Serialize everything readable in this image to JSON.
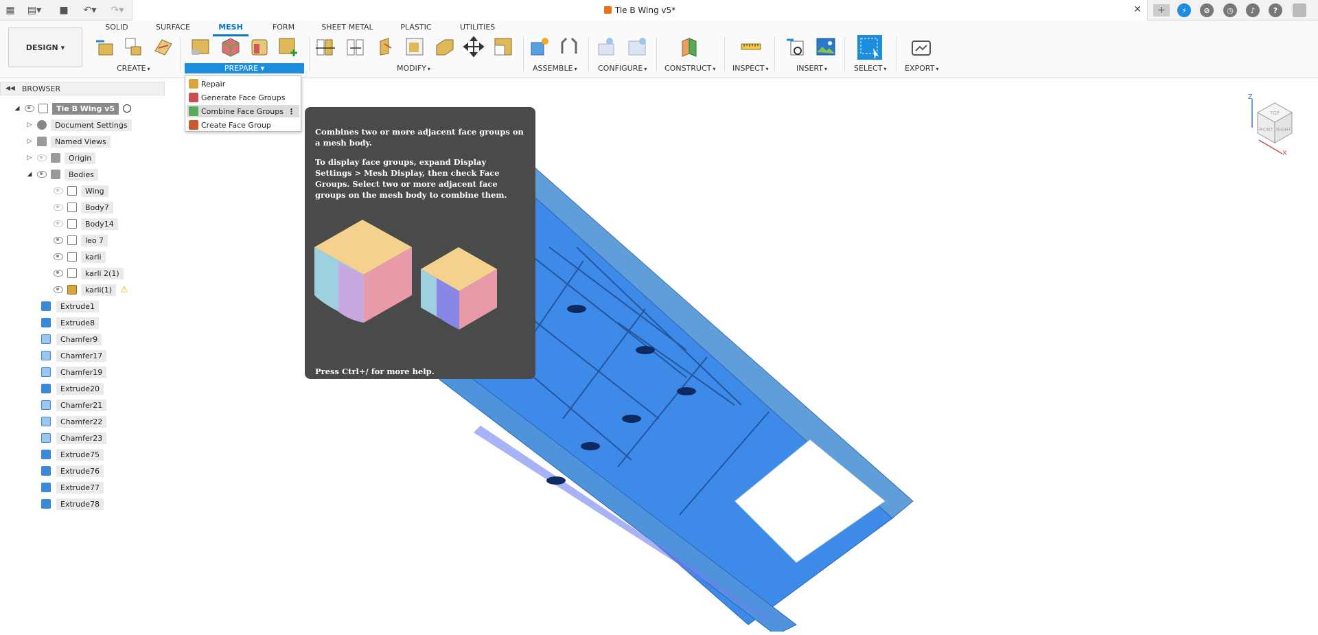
{
  "window": {
    "document_title": "Tie B Wing v5*"
  },
  "workspace_switcher": {
    "label": "DESIGN"
  },
  "workspace_tabs": [
    {
      "label": "SOLID"
    },
    {
      "label": "SURFACE"
    },
    {
      "label": "MESH"
    },
    {
      "label": "FORM"
    },
    {
      "label": "SHEET METAL"
    },
    {
      "label": "PLASTIC"
    },
    {
      "label": "UTILITIES"
    }
  ],
  "tool_groups": {
    "create": "CREATE",
    "prepare": "PREPARE",
    "modify": "MODIFY",
    "assemble": "ASSEMBLE",
    "configure": "CONFIGURE",
    "construct": "CONSTRUCT",
    "inspect": "INSPECT",
    "insert": "INSERT",
    "select": "SELECT",
    "export": "EXPORT"
  },
  "prepare_menu": {
    "items": [
      {
        "label": "Repair",
        "color": "#d9a43a"
      },
      {
        "label": "Generate Face Groups",
        "color": "#c94f4f"
      },
      {
        "label": "Combine Face Groups",
        "color": "#5aa85a"
      },
      {
        "label": "Create Face Group",
        "color": "#c95a2c"
      }
    ]
  },
  "tooltip": {
    "summary": "Combines two or more adjacent face groups on a mesh body.",
    "detail": "To display face groups, expand Display Settings > Mesh Display, then check Face Groups. Select two or more adjacent face groups on the mesh body to combine them.",
    "help": "Press Ctrl+/ for more help."
  },
  "browser": {
    "title": "BROWSER",
    "root": "Tie B Wing v5",
    "nodes": [
      {
        "label": "Document Settings"
      },
      {
        "label": "Named Views"
      },
      {
        "label": "Origin"
      },
      {
        "label": "Bodies"
      }
    ],
    "bodies": [
      {
        "label": "Wing"
      },
      {
        "label": "Body7"
      },
      {
        "label": "Body14"
      },
      {
        "label": "leo 7"
      },
      {
        "label": "karli"
      },
      {
        "label": "karli 2(1)"
      },
      {
        "label": "karli(1)"
      }
    ]
  },
  "timeline": [
    {
      "label": "Extrude1"
    },
    {
      "label": "Extrude8"
    },
    {
      "label": "Chamfer9"
    },
    {
      "label": "Chamfer17"
    },
    {
      "label": "Chamfer19"
    },
    {
      "label": "Extrude20"
    },
    {
      "label": "Chamfer21"
    },
    {
      "label": "Chamfer22"
    },
    {
      "label": "Chamfer23"
    },
    {
      "label": "Extrude75"
    },
    {
      "label": "Extrude76"
    },
    {
      "label": "Extrude77"
    },
    {
      "label": "Extrude78"
    }
  ],
  "viewcube": {
    "top": "TOP",
    "front": "FRONT",
    "right": "RIGHT",
    "axis_z": "Z",
    "axis_x": "X"
  },
  "colors": {
    "accent": "#0b78c8",
    "menu_highlight": "#1d8de0",
    "tooltip_bg": "#4a4a4a",
    "model_blue": "#3d8ae8"
  }
}
